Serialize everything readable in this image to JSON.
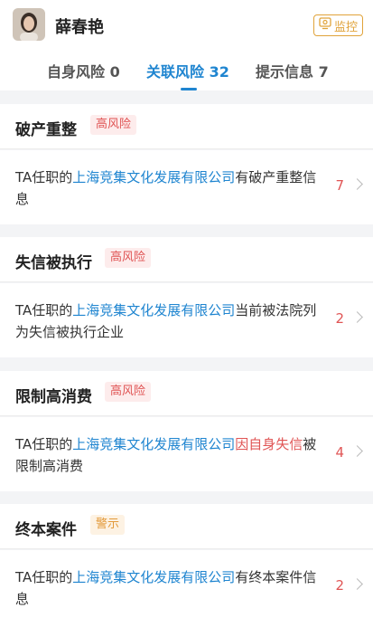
{
  "header": {
    "name": "薛春艳",
    "monitor_label": "监控"
  },
  "tabs": [
    {
      "label": "自身风险 0"
    },
    {
      "label": "关联风险 32"
    },
    {
      "label": "提示信息 7"
    }
  ],
  "sections": [
    {
      "title": "破产重整",
      "tag": "高风险",
      "prefix": "TA任职的",
      "company": "上海竞集文化发展有限公司",
      "suffix_red": "",
      "suffix": "有破产重整信息",
      "count": "7"
    },
    {
      "title": "失信被执行",
      "tag": "高风险",
      "prefix": "TA任职的",
      "company": "上海竞集文化发展有限公司",
      "suffix_red": "",
      "suffix": "当前被法院列为失信被执行企业",
      "count": "2"
    },
    {
      "title": "限制高消费",
      "tag": "高风险",
      "prefix": "TA任职的",
      "company": "上海竞集文化发展有限公司",
      "suffix_red": "因自身失信",
      "suffix": "被限制高消费",
      "count": "4"
    },
    {
      "title": "终本案件",
      "tag": "警示",
      "prefix": "TA任职的",
      "company": "上海竞集文化发展有限公司",
      "suffix_red": "",
      "suffix": "有终本案件信息",
      "count": "2"
    }
  ],
  "colors": {
    "accent": "#1f85d0",
    "danger": "#e05555",
    "warn": "#e39a3a"
  }
}
